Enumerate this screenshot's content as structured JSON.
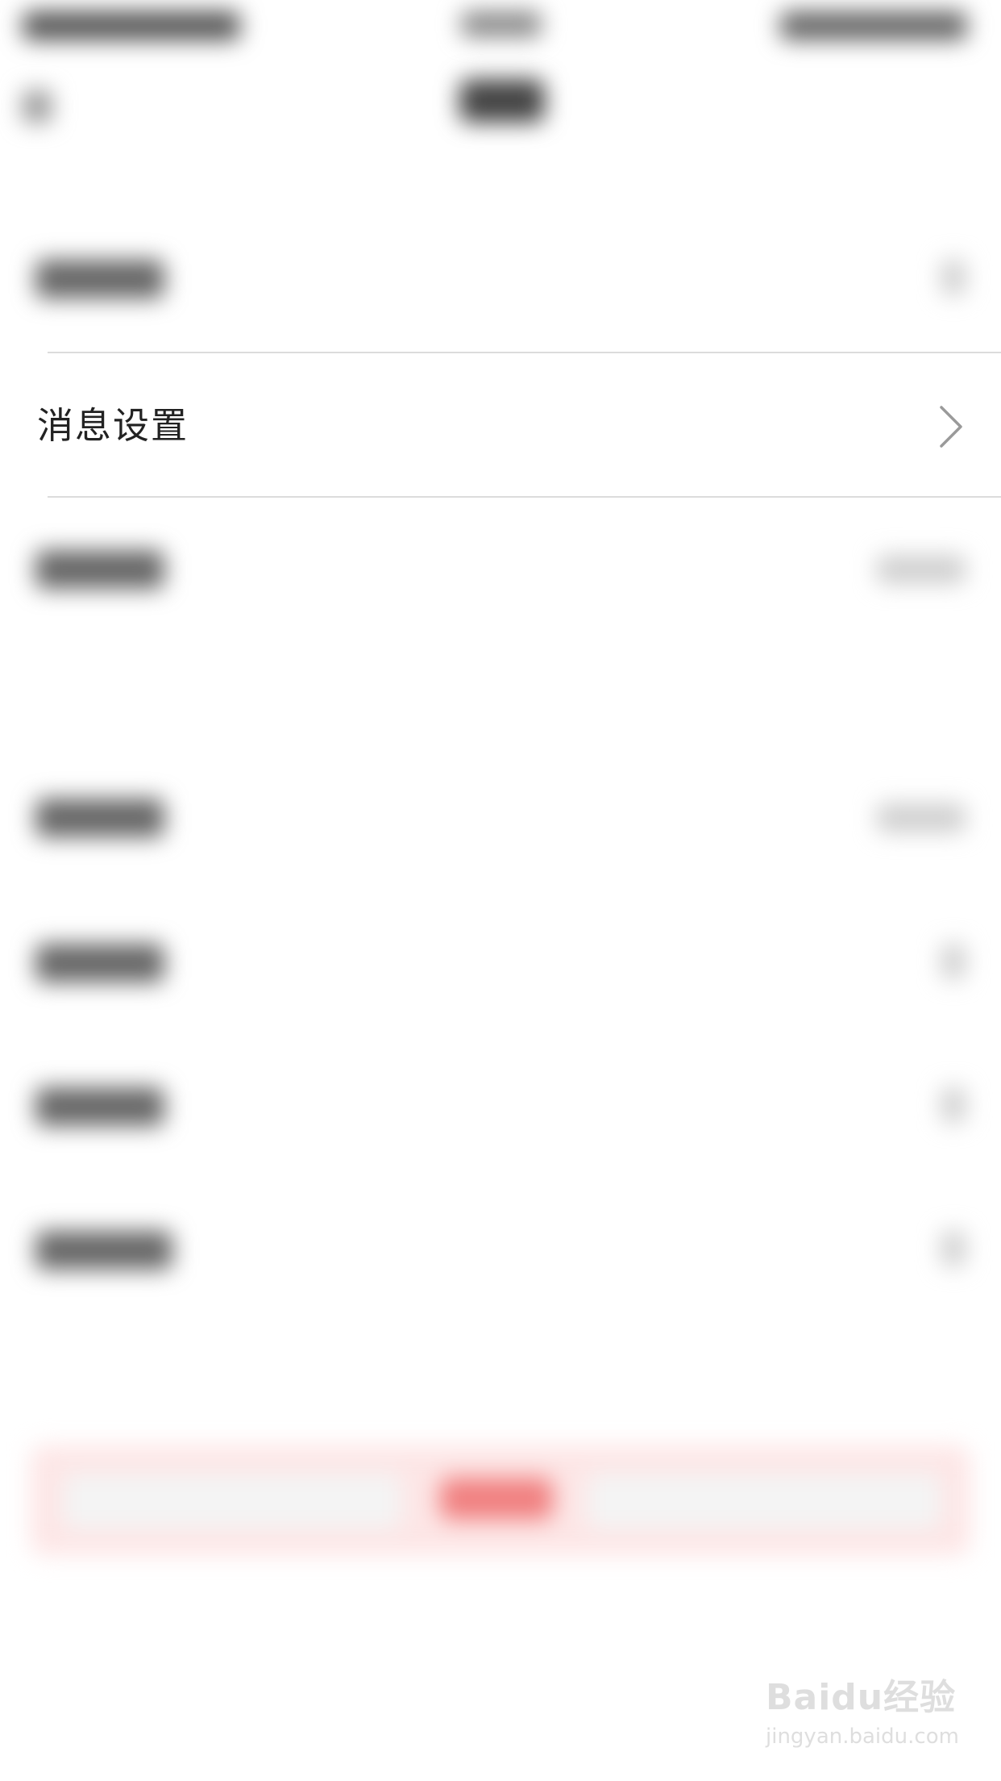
{
  "settings": {
    "rows": [
      {
        "label": "消息设置"
      }
    ]
  },
  "watermark": {
    "logo": "Baidu经验",
    "url": "jingyan.baidu.com"
  }
}
